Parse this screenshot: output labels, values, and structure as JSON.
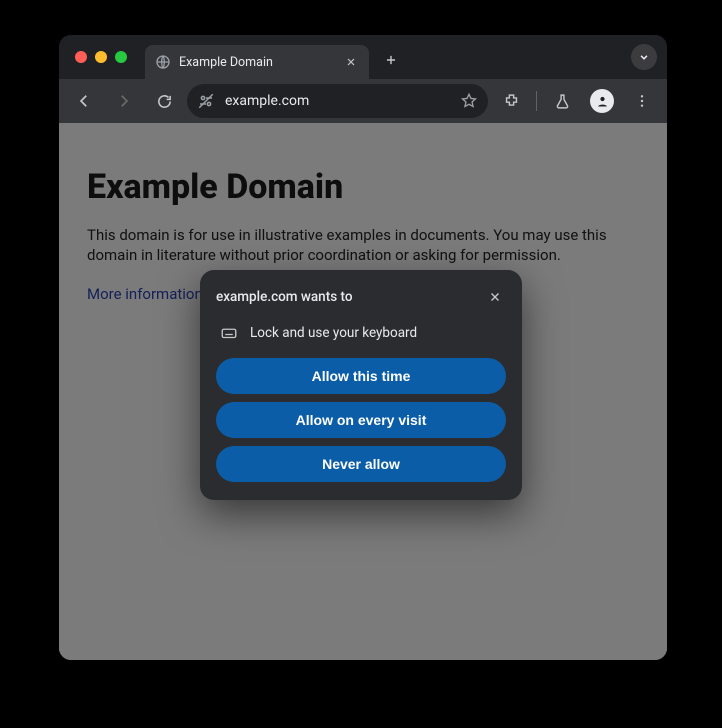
{
  "tab": {
    "title": "Example Domain"
  },
  "toolbar": {
    "url": "example.com"
  },
  "page": {
    "heading": "Example Domain",
    "paragraph": "This domain is for use in illustrative examples in documents. You may use this domain in literature without prior coordination or asking for permission.",
    "link": "More information..."
  },
  "permission": {
    "title": "example.com wants to",
    "item": "Lock and use your keyboard",
    "allow_once": "Allow this time",
    "allow_every": "Allow on every visit",
    "never": "Never allow"
  }
}
